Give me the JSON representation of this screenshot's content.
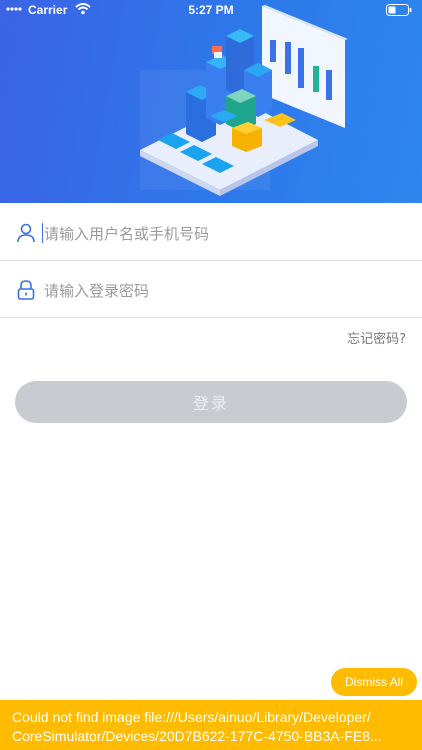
{
  "status_bar": {
    "carrier": "Carrier",
    "time": "5:27 PM",
    "signal_icon": "signal-dots-icon",
    "wifi_icon": "wifi-icon",
    "battery_icon": "battery-icon"
  },
  "hero": {
    "illustration": "data-dashboard-illustration",
    "background_color": "#3168e8"
  },
  "login_form": {
    "username_placeholder": "请输入用户名或手机号码",
    "username_icon": "user-icon",
    "password_placeholder": "请输入登录密码",
    "password_icon": "lock-icon",
    "forgot_password": "忘记密码?",
    "login_button": "登录"
  },
  "debug": {
    "dismiss_all": "Dismiss All",
    "error_line1": "Could not find image file:///Users/ainuo/Library/Developer/",
    "error_line2": "CoreSimulator/Devices/20D7B622-177C-4750-BB3A-FE8..."
  },
  "colors": {
    "accent": "#3a6ee8",
    "warning": "#ffbb00",
    "button_disabled": "#c8cbd0"
  }
}
